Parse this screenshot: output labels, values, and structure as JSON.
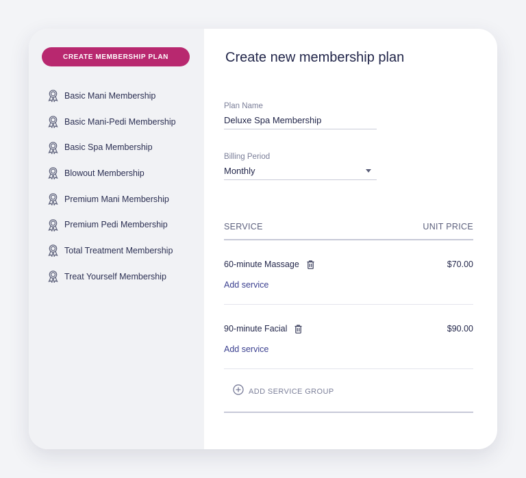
{
  "sidebar": {
    "create_button": "CREATE MEMBERSHIP PLAN",
    "plans": [
      "Basic Mani Membership",
      "Basic Mani-Pedi Membership",
      "Basic Spa Membership",
      "Blowout Membership",
      "Premium Mani Membership",
      "Premium Pedi Membership",
      "Total Treatment Membership",
      "Treat Yourself Membership"
    ],
    "plan_icon": "award-ribbon-icon"
  },
  "main": {
    "title": "Create new membership plan",
    "plan_name": {
      "label": "Plan Name",
      "value": "Deluxe Spa Membership"
    },
    "billing_period": {
      "label": "Billing Period",
      "value": "Monthly"
    },
    "table": {
      "col_service": "SERVICE",
      "col_price": "UNIT PRICE",
      "rows": [
        {
          "service": "60-minute Massage",
          "price": "$70.00",
          "add": "Add service"
        },
        {
          "service": "90-minute Facial",
          "price": "$90.00",
          "add": "Add service"
        }
      ],
      "add_group": "ADD SERVICE GROUP"
    }
  },
  "colors": {
    "accent": "#b8286f",
    "text": "#22264a",
    "link": "#3a3f8f",
    "sidebar_bg": "#f1f2f5"
  }
}
